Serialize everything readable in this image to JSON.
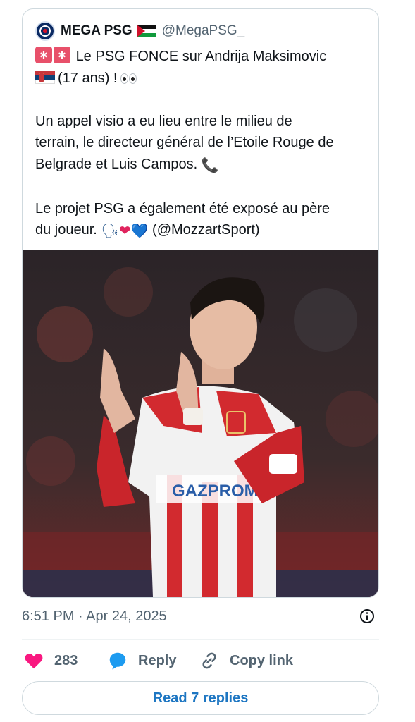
{
  "quote": {
    "author_name": "MEGA PSG",
    "author_handle": "@MegaPSG_",
    "flag_icon": "palestine-flag-icon",
    "line1": "Le PSG FONCE sur Andrija Maksimovic",
    "line2": "(17 ans) !",
    "para2_l1": "Un appel visio a eu lieu entre le milieu de",
    "para2_l2": "terrain, le directeur général de l’Etoile Rouge de",
    "para2_l3": "Belgrade et Luis Campos.",
    "para3_l1": "Le projet PSG a également été exposé au père",
    "para3_l2": "du joueur.",
    "para3_mention": "(@MozzartSport)",
    "image_description_icon": "player-photo"
  },
  "meta": {
    "timestamp": "6:51 PM · Apr 24, 2025"
  },
  "actions": {
    "like_count": "283",
    "reply_label": "Reply",
    "copy_label": "Copy link"
  },
  "read_replies": "Read 7 replies",
  "colors": {
    "like": "#f91880",
    "reply": "#1d9bf0",
    "link": "#1d76c2",
    "muted": "#536471"
  }
}
